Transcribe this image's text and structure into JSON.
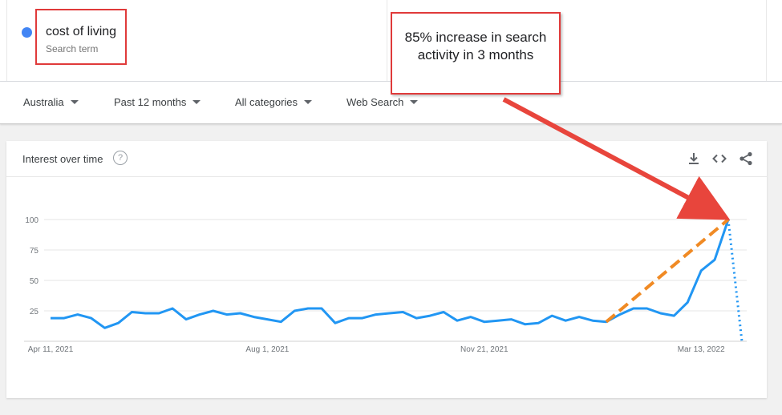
{
  "search_term": {
    "name": "cost of living",
    "subtitle": "Search term",
    "color": "#4285f4"
  },
  "filters": [
    {
      "label": "Australia"
    },
    {
      "label": "Past 12 months"
    },
    {
      "label": "All categories"
    },
    {
      "label": "Web Search"
    }
  ],
  "card": {
    "title": "Interest over time",
    "help_icon": "help-icon",
    "actions": [
      "download-icon",
      "embed-icon",
      "share-icon"
    ]
  },
  "annotation": {
    "text": "85% increase in search activity in 3 months",
    "border_color": "#e03a3a",
    "arrow_color": "#e8453c",
    "trend_color": "#f08a24"
  },
  "chart_data": {
    "type": "line",
    "x_tick_labels": [
      "Apr 11, 2021",
      "Aug 1, 2021",
      "Nov 21, 2021",
      "Mar 13, 2022"
    ],
    "y_ticks": [
      25,
      50,
      75,
      100
    ],
    "ylim": [
      0,
      100
    ],
    "grid": true,
    "series": [
      {
        "color": "#2196f3",
        "values": [
          19,
          19,
          22,
          19,
          11,
          15,
          24,
          23,
          23,
          27,
          18,
          22,
          25,
          22,
          23,
          20,
          18,
          16,
          25,
          27,
          27,
          15,
          19,
          19,
          22,
          23,
          24,
          19,
          21,
          24,
          17,
          20,
          16,
          17,
          18,
          14,
          15,
          21,
          17,
          20,
          17,
          16,
          22,
          27,
          27,
          23,
          21,
          32,
          58,
          67,
          100
        ]
      }
    ],
    "partial_tail": [
      100,
      0
    ],
    "trend_line": {
      "from_index": 41,
      "to_index": 50
    }
  }
}
